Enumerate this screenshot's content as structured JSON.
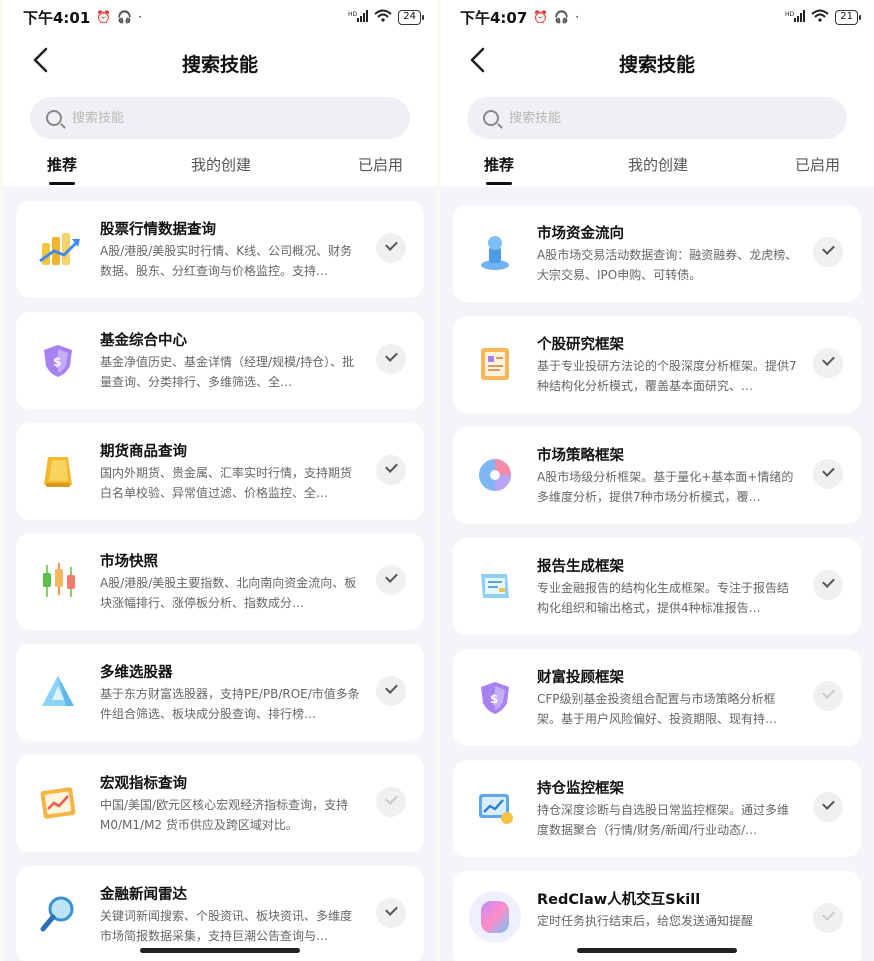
{
  "left": {
    "status": {
      "time": "下午4:01",
      "battery": "24",
      "net": "HD"
    },
    "title": "搜索技能",
    "search_placeholder": "搜索技能",
    "tabs": [
      "推荐",
      "我的创建",
      "已启用"
    ],
    "cards": [
      {
        "title": "股票行情数据查询",
        "desc": "A股/港股/美股实时行情、K线、公司概况、财务数据、股东、分红查询与价格监控。支持…",
        "icon": "stock-chart-icon",
        "enabled": true
      },
      {
        "title": "基金综合中心",
        "desc": "基金净值历史、基金详情（经理/规模/持仓）、批量查询、分类排行、多维筛选、全…",
        "icon": "shield-fund-icon",
        "enabled": true
      },
      {
        "title": "期货商品查询",
        "desc": "国内外期货、贵金属、汇率实时行情，支持期货白名单校验、异常值过滤、价格监控、全…",
        "icon": "gold-bar-icon",
        "enabled": true
      },
      {
        "title": "市场快照",
        "desc": "A股/港股/美股主要指数、北向南向资金流向、板块涨幅排行、涨停板分析、指数成分…",
        "icon": "candlestick-icon",
        "enabled": true
      },
      {
        "title": "多维选股器",
        "desc": "基于东方财富选股器，支持PE/PB/ROE/市值多条件组合筛选、板块成分股查询、排行榜…",
        "icon": "prism-icon",
        "enabled": true
      },
      {
        "title": "宏观指标查询",
        "desc": "中国/美国/欧元区核心宏观经济指标查询，支持 M0/M1/M2 货币供应及跨区域对比。",
        "icon": "trend-board-icon",
        "enabled": false
      },
      {
        "title": "金融新闻雷达",
        "desc": "关键词新闻搜索、个股资讯、板块资讯、多维度市场简报数据采集，支持巨潮公告查询与…",
        "icon": "magnifier-icon",
        "enabled": true
      }
    ]
  },
  "right": {
    "status": {
      "time": "下午4:07",
      "battery": "21",
      "net": "HD"
    },
    "title": "搜索技能",
    "search_placeholder": "搜索技能",
    "tabs": [
      "推荐",
      "我的创建",
      "已启用"
    ],
    "cards": [
      {
        "title": "市场资金流向",
        "desc": "A股市场交易活动数据查询：融资融券、龙虎榜、大宗交易、IPO申购、可转债。",
        "icon": "stamp-icon",
        "enabled": true
      },
      {
        "title": "个股研究框架",
        "desc": "基于专业投研方法论的个股深度分析框架。提供7种结构化分析模式，覆盖基本面研究、…",
        "icon": "report-doc-icon",
        "enabled": true
      },
      {
        "title": "市场策略框架",
        "desc": "A股市场级分析框架。基于量化+基本面+情绪的多维度分析，提供7种市场分析模式，覆…",
        "icon": "pie-disc-icon",
        "enabled": true
      },
      {
        "title": "报告生成框架",
        "desc": "专业金融报告的结构化生成框架。专注于报告结构化组织和输出格式，提供4种标准报告…",
        "icon": "paper-scroll-icon",
        "enabled": true
      },
      {
        "title": "财富投顾框架",
        "desc": "CFP级别基金投资组合配置与市场策略分析框架。基于用户风险偏好、投资期限、现有持…",
        "icon": "shield-fund-icon",
        "enabled": false
      },
      {
        "title": "持仓监控框架",
        "desc": "持仓深度诊断与自选股日常监控框架。通过多维度数据聚合（行情/财务/新闻/行业动态/…",
        "icon": "monitor-chart-icon",
        "enabled": true
      },
      {
        "title": "RedClaw人机交互Skill",
        "desc": "定时任务执行结束后，给您发送通知提醒",
        "icon": "redclaw-orb-icon",
        "enabled": false
      }
    ]
  }
}
